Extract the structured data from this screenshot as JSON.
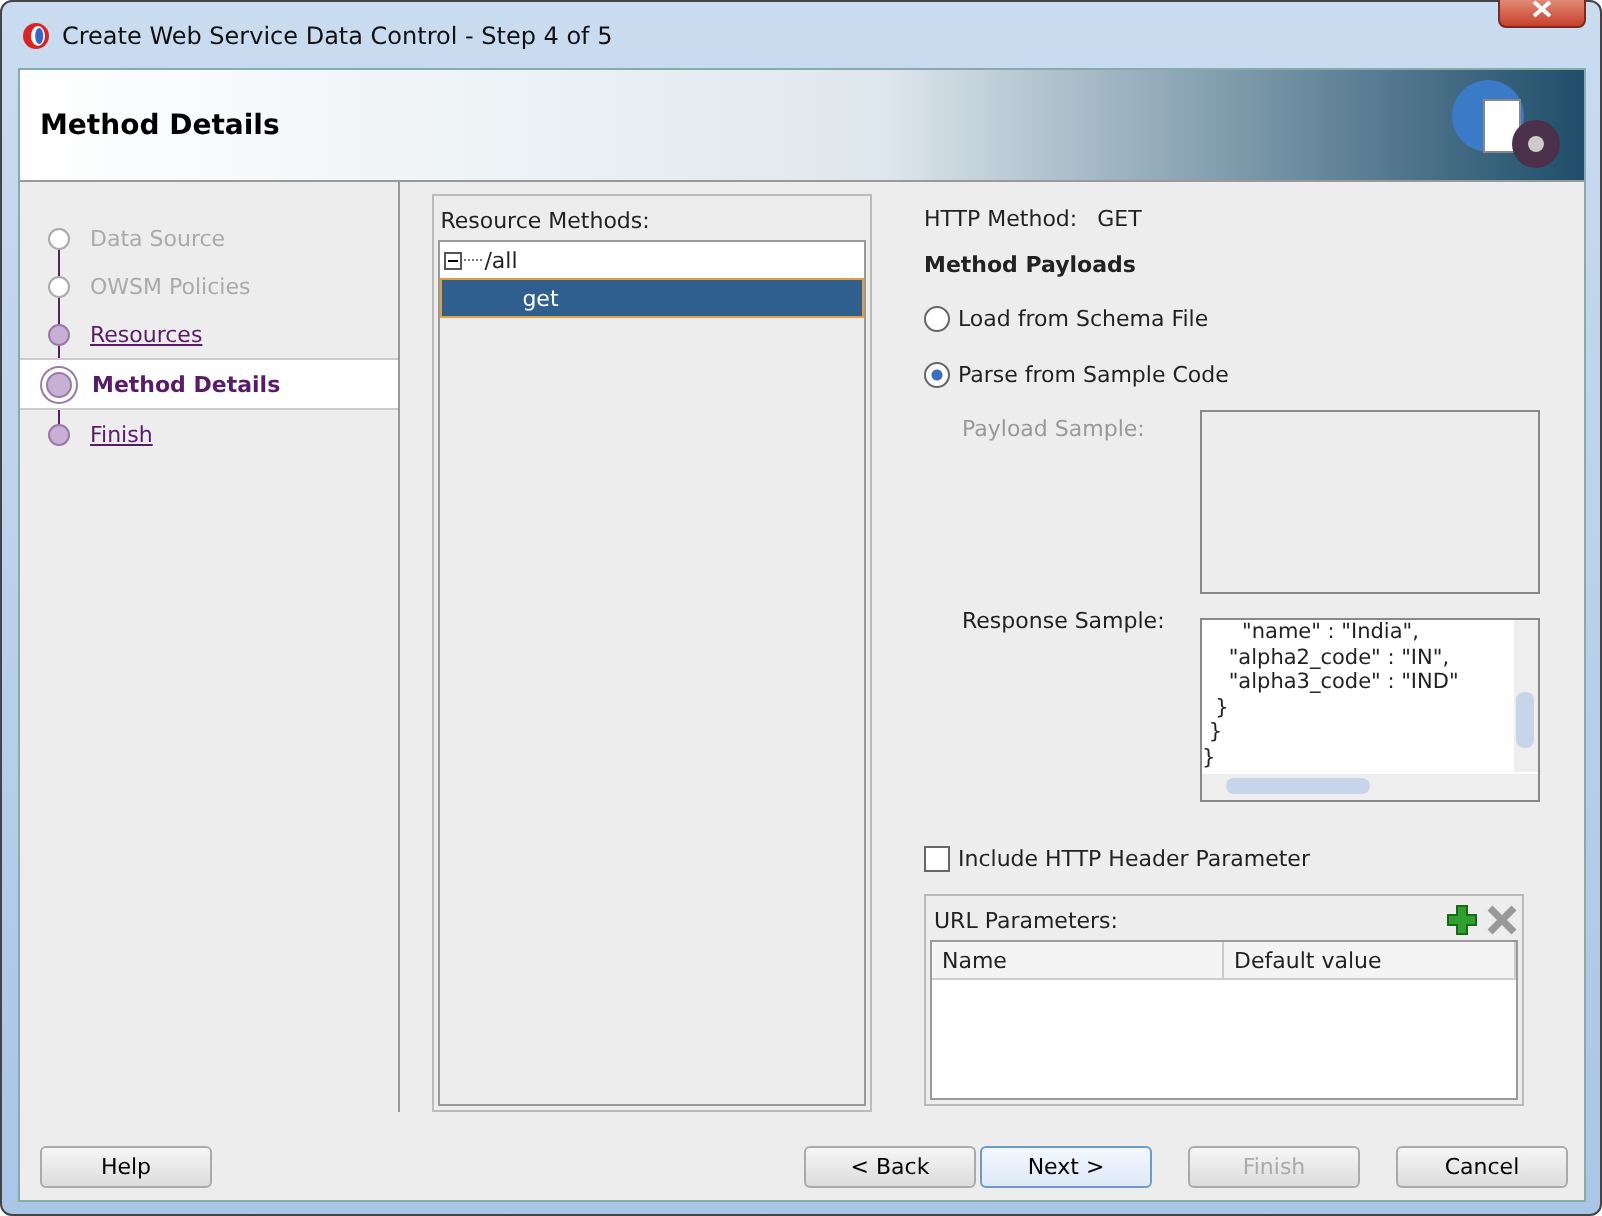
{
  "window": {
    "title": "Create Web Service Data Control - Step 4 of 5"
  },
  "header": {
    "title": "Method Details"
  },
  "steps": [
    {
      "label": "Data Source",
      "selected": false,
      "disabled": true
    },
    {
      "label": "OWSM Policies",
      "selected": false,
      "disabled": true
    },
    {
      "label": "Resources",
      "selected": false,
      "disabled": false
    },
    {
      "label": "Method Details",
      "selected": true,
      "disabled": false
    },
    {
      "label": "Finish",
      "selected": false,
      "disabled": false
    }
  ],
  "resource_methods": {
    "label": "Resource Methods:",
    "tree": [
      {
        "label": "/all",
        "expanded": true,
        "selected": false,
        "children": [
          {
            "label": "get",
            "selected": true
          }
        ]
      }
    ]
  },
  "http_method": {
    "label": "HTTP Method:",
    "value": "GET"
  },
  "method_payloads": {
    "title": "Method Payloads",
    "options": [
      {
        "label": "Load from Schema File",
        "selected": false
      },
      {
        "label": "Parse from Sample Code",
        "selected": true
      }
    ]
  },
  "payload_sample": {
    "label": "Payload Sample:",
    "disabled": true
  },
  "response_sample": {
    "label": "Response Sample:",
    "lines": [
      "      \"name\" : \"India\",",
      "    \"alpha2_code\" : \"IN\",",
      "    \"alpha3_code\" : \"IND\"",
      "  }",
      " }",
      "}"
    ]
  },
  "include_header": {
    "label": "Include HTTP Header Parameter",
    "checked": false
  },
  "url_parameters": {
    "label": "URL Parameters:",
    "columns": [
      "Name",
      "Default value"
    ]
  },
  "buttons": [
    {
      "label": "Help",
      "disabled": false,
      "focused": false
    },
    {
      "label": "< Back",
      "disabled": false,
      "focused": false
    },
    {
      "label": "Next >",
      "disabled": false,
      "focused": true
    },
    {
      "label": "Finish",
      "disabled": true,
      "focused": false
    },
    {
      "label": "Cancel",
      "disabled": false,
      "focused": false
    }
  ]
}
